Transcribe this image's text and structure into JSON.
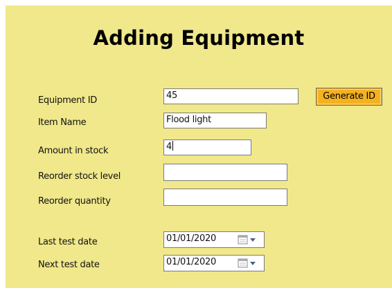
{
  "form": {
    "title": "Adding Equipment",
    "background_color": "#f0e88a"
  },
  "fields": {
    "equipment_id": {
      "label": "Equipment ID",
      "value": "45"
    },
    "item_name": {
      "label": "Item Name",
      "value": "Flood light"
    },
    "amount_in_stock": {
      "label": "Amount in stock",
      "value": "4"
    },
    "reorder_stock_level": {
      "label": "Reorder stock level",
      "value": ""
    },
    "reorder_quantity": {
      "label": "Reorder quantity",
      "value": ""
    },
    "last_test_date": {
      "label": "Last test date",
      "value": "01/01/2020"
    },
    "next_test_date": {
      "label": "Next test date",
      "value": "01/01/2020"
    }
  },
  "buttons": {
    "generate_id": {
      "label": "Generate ID",
      "color": "#f4b120"
    }
  },
  "icons": {
    "date_picker": "calendar-dropdown-icon"
  }
}
